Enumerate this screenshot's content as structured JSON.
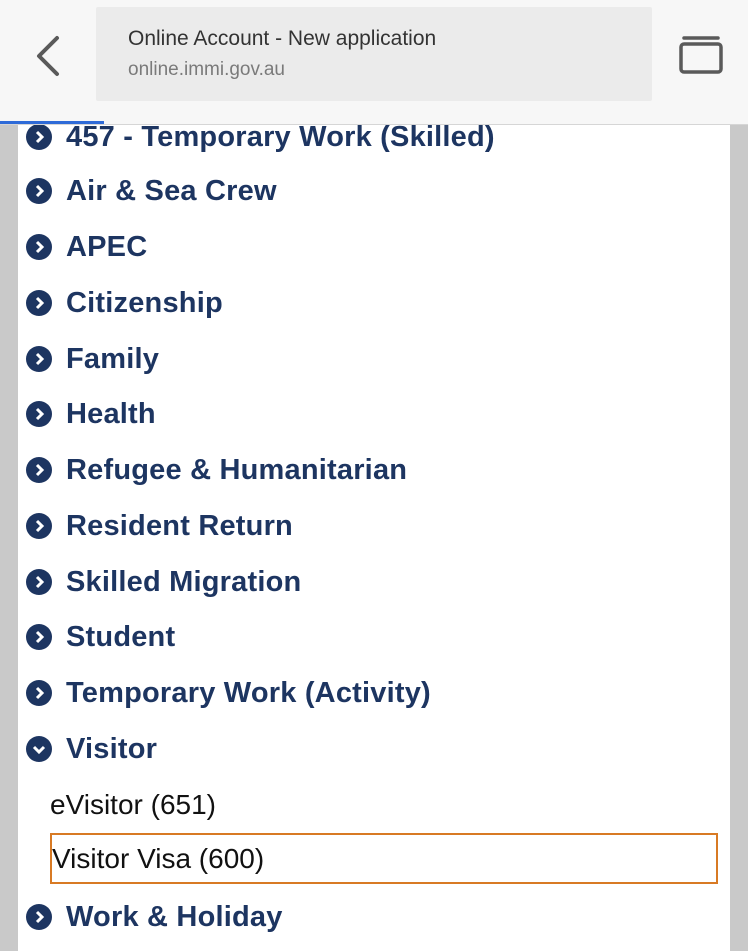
{
  "browser": {
    "title": "Online Account - New application",
    "domain": "online.immi.gov.au"
  },
  "categories": [
    {
      "label": "457 - Temporary Work (Skilled)",
      "state": "collapsed"
    },
    {
      "label": "Air & Sea Crew",
      "state": "collapsed"
    },
    {
      "label": "APEC",
      "state": "collapsed"
    },
    {
      "label": "Citizenship",
      "state": "collapsed"
    },
    {
      "label": "Family",
      "state": "collapsed"
    },
    {
      "label": "Health",
      "state": "collapsed"
    },
    {
      "label": "Refugee & Humanitarian",
      "state": "collapsed"
    },
    {
      "label": "Resident Return",
      "state": "collapsed"
    },
    {
      "label": "Skilled Migration",
      "state": "collapsed"
    },
    {
      "label": "Student",
      "state": "collapsed"
    },
    {
      "label": "Temporary Work (Activity)",
      "state": "collapsed"
    },
    {
      "label": "Visitor",
      "state": "expanded"
    },
    {
      "label": "Work & Holiday",
      "state": "collapsed"
    }
  ],
  "visitor_items": [
    {
      "label": "eVisitor (651)"
    },
    {
      "label": "Visitor Visa (600)",
      "highlighted": true
    }
  ],
  "colors": {
    "accent": "#1d3561",
    "highlight_border": "#d87a24",
    "progress": "#2f6bd8"
  }
}
